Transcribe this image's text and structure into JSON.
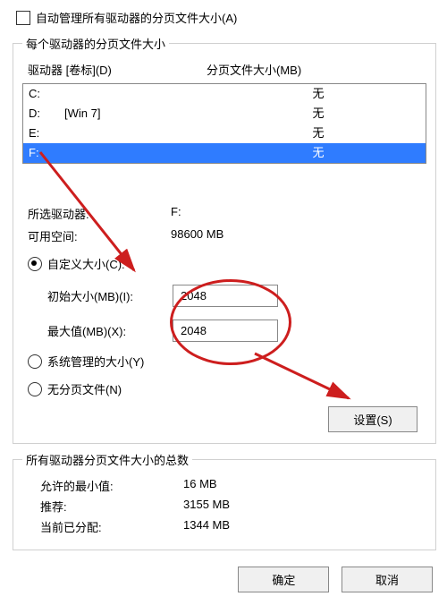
{
  "auto_manage_label": "自动管理所有驱动器的分页文件大小(A)",
  "per_drive_group": "每个驱动器的分页文件大小",
  "header_drive": "驱动器 [卷标](D)",
  "header_pf": "分页文件大小(MB)",
  "drives": [
    {
      "letter": "C:",
      "label": "",
      "pf": "无",
      "selected": false
    },
    {
      "letter": "D:",
      "label": "[Win 7]",
      "pf": "无",
      "selected": false
    },
    {
      "letter": "E:",
      "label": "",
      "pf": "无",
      "selected": false
    },
    {
      "letter": "F:",
      "label": "",
      "pf": "无",
      "selected": true
    }
  ],
  "selected_drive_label": "所选驱动器:",
  "selected_drive_value": "F:",
  "avail_space_label": "可用空间:",
  "avail_space_value": "98600 MB",
  "radio_custom": "自定义大小(C):",
  "initial_label": "初始大小(MB)(I):",
  "initial_value": "2048",
  "max_label": "最大值(MB)(X):",
  "max_value": "2048",
  "radio_system": "系统管理的大小(Y)",
  "radio_none": "无分页文件(N)",
  "set_button": "设置(S)",
  "totals_group": "所有驱动器分页文件大小的总数",
  "min_label": "允许的最小值:",
  "min_value": "16 MB",
  "rec_label": "推荐:",
  "rec_value": "3155 MB",
  "cur_label": "当前已分配:",
  "cur_value": "1344 MB",
  "ok_button": "确定",
  "cancel_button": "取消"
}
